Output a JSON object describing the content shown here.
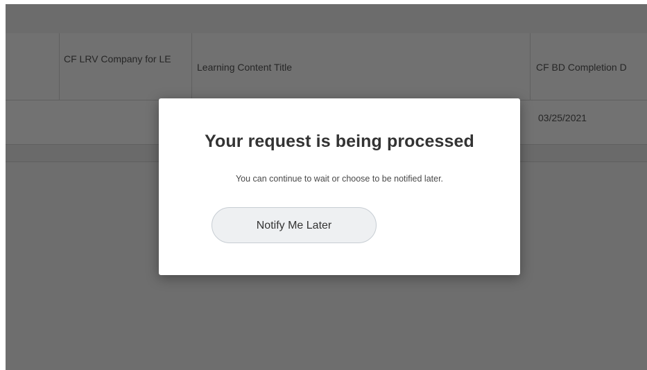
{
  "table": {
    "columns": [
      "CF LRV Company for LE",
      "Learning Content Title",
      "CF BD Completion D"
    ],
    "rows": [
      [
        "",
        "",
        "03/25/2021"
      ]
    ]
  },
  "modal": {
    "title": "Your request is being processed",
    "message": "You can continue to wait or choose to be notified later.",
    "button_label": "Notify Me Later"
  },
  "colors": {
    "overlay": "#6e6e6e",
    "modal_background": "#ffffff",
    "button_background": "#eef0f2",
    "button_border": "#c7cdd3",
    "title_text": "#333333"
  }
}
